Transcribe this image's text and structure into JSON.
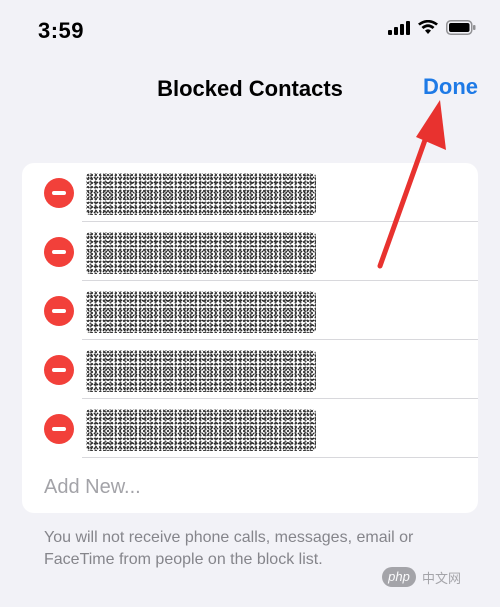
{
  "status_bar": {
    "time": "3:59",
    "icons": [
      "cellular-signal-icon",
      "wifi-icon",
      "battery-icon"
    ]
  },
  "nav": {
    "title": "Blocked Contacts",
    "done_label": "Done"
  },
  "blocked_list": {
    "rows": [
      {
        "name": "",
        "redacted": true
      },
      {
        "name": "",
        "redacted": true
      },
      {
        "name": "",
        "redacted": true
      },
      {
        "name": "",
        "redacted": true
      },
      {
        "name": "",
        "redacted": true
      }
    ],
    "add_new_label": "Add New..."
  },
  "footer_note": "You will not receive phone calls, messages, email or FaceTime from people on the block list.",
  "watermark": {
    "badge": "php",
    "text": "中文网"
  },
  "colors": {
    "accent": "#1e7ae6",
    "delete": "#f2403a",
    "arrow": "#e8322f",
    "background": "#f2f2f7"
  }
}
